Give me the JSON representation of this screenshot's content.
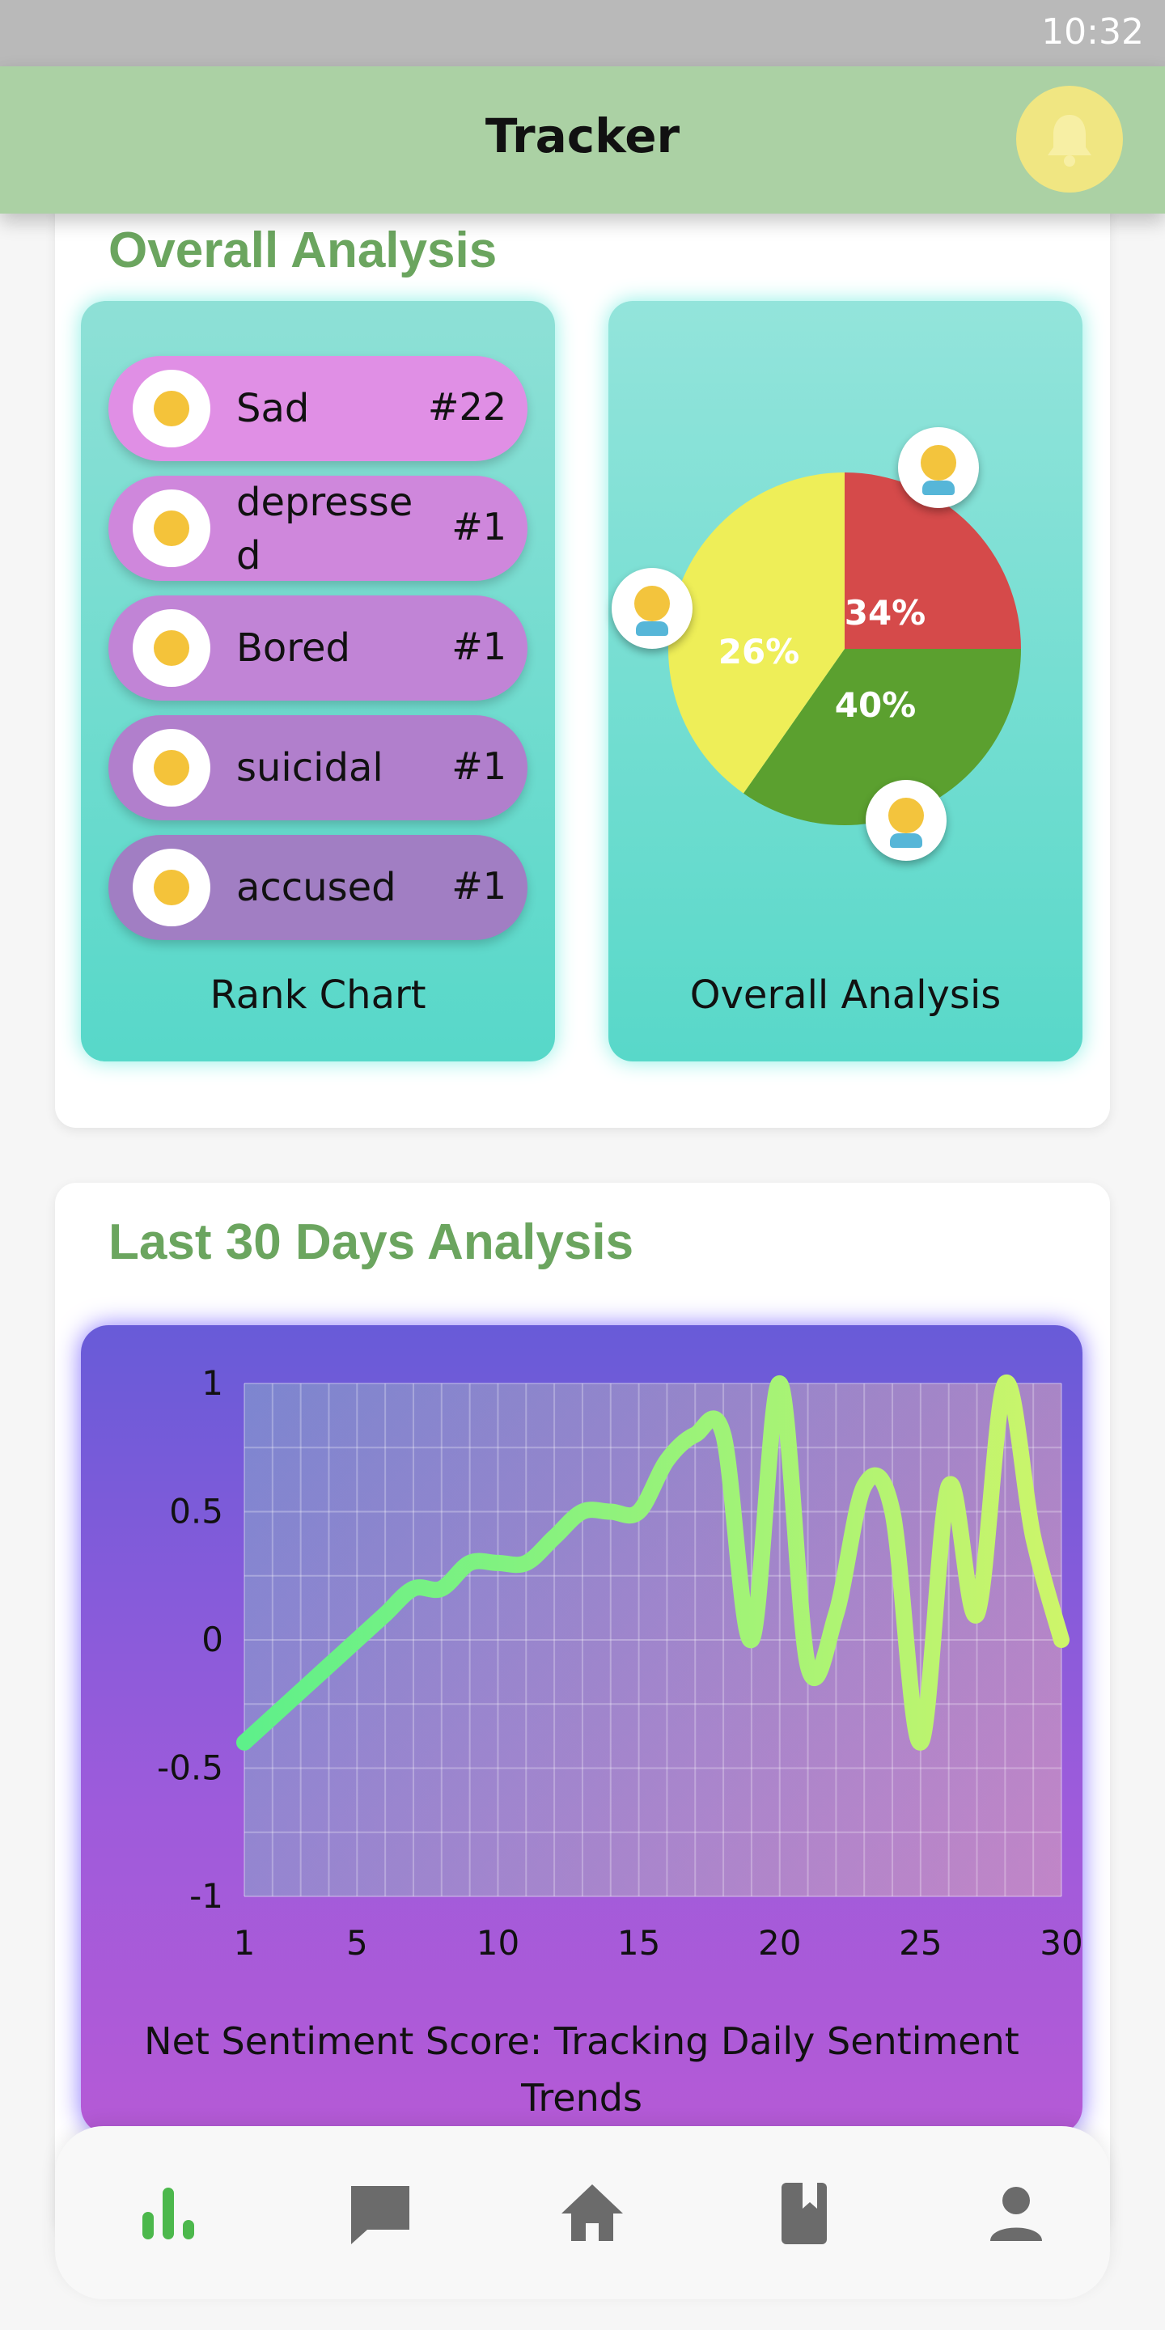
{
  "status_bar": {
    "time": "10:32"
  },
  "app_bar": {
    "title": "Tracker",
    "bell_icon": "bell-icon"
  },
  "overall": {
    "title": "Overall Analysis",
    "rank_chart": {
      "caption": "Rank Chart",
      "items": [
        {
          "name": "Sad",
          "count": "#22",
          "color": "#e08fe5",
          "icon": "sad-emoji-icon"
        },
        {
          "name": "depresse d",
          "count": "#1",
          "color": "#cf87dc",
          "icon": "crying-emoji-icon"
        },
        {
          "name": "Bored",
          "count": "#1",
          "color": "#c184d6",
          "icon": "frown-emoji-icon"
        },
        {
          "name": "suicidal",
          "count": "#1",
          "color": "#b17fcc",
          "icon": "weary-emoji-icon"
        },
        {
          "name": "accused",
          "count": "#1",
          "color": "#a17ec3",
          "icon": "flushed-emoji-icon"
        }
      ]
    },
    "pie": {
      "caption": "Overall Analysis",
      "slices": [
        {
          "label": "34%",
          "value": 34,
          "color": "#d54a4a"
        },
        {
          "label": "40%",
          "value": 40,
          "color": "#5ba02f"
        },
        {
          "label": "26%",
          "value": 26,
          "color": "#eeee58"
        }
      ],
      "icons": [
        "sad-person-icon",
        "happy-person-icon",
        "neutral-person-icon"
      ]
    }
  },
  "last30": {
    "title": "Last 30 Days Analysis",
    "caption": "Net Sentiment Score: Tracking Daily Sentiment Trends"
  },
  "nav": [
    {
      "name": "bar-chart-icon",
      "active": true
    },
    {
      "name": "chat-icon",
      "active": false
    },
    {
      "name": "home-icon",
      "active": false
    },
    {
      "name": "book-icon",
      "active": false
    },
    {
      "name": "profile-icon",
      "active": false
    }
  ],
  "chart_data": {
    "type": "line",
    "title": "",
    "xlabel": "",
    "ylabel": "",
    "x": [
      1,
      2,
      3,
      4,
      5,
      6,
      7,
      8,
      9,
      10,
      11,
      12,
      13,
      14,
      15,
      16,
      17,
      18,
      19,
      20,
      21,
      22,
      23,
      24,
      25,
      26,
      27,
      28,
      29,
      30
    ],
    "series": [
      {
        "values": [
          -0.4,
          -0.3,
          -0.2,
          -0.1,
          0.0,
          0.1,
          0.2,
          0.2,
          0.3,
          0.3,
          0.3,
          0.4,
          0.5,
          0.5,
          0.5,
          0.7,
          0.8,
          0.8,
          0.0,
          1.0,
          -0.1,
          0.1,
          0.6,
          0.5,
          -0.4,
          0.6,
          0.1,
          1.0,
          0.4,
          0.0
        ]
      }
    ],
    "xlim": [
      1,
      30
    ],
    "ylim": [
      -1,
      1
    ],
    "xticks": [
      "1",
      "5",
      "10",
      "15",
      "20",
      "25",
      "30"
    ],
    "yticks": [
      "1",
      "0.5",
      "0",
      "-0.5",
      "-1"
    ],
    "grid": true,
    "line_gradient": [
      "#5ef08a",
      "#cdf56a"
    ]
  }
}
